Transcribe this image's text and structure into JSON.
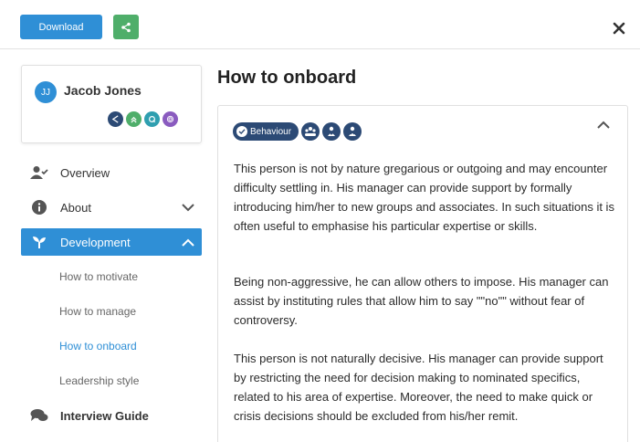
{
  "toolbar": {
    "download_label": "Download",
    "share_icon": "share-icon",
    "close_icon": "close-icon"
  },
  "profile": {
    "initials": "JJ",
    "name": "Jacob Jones",
    "trait_icons": [
      {
        "icon": "send-icon",
        "color": "#2c4a75"
      },
      {
        "icon": "chevrons-up-icon",
        "color": "#4fae6a"
      },
      {
        "icon": "q-icon",
        "color": "#2f9fb0"
      },
      {
        "icon": "rings-icon",
        "color": "#8a5bbf"
      }
    ]
  },
  "nav": {
    "overview": "Overview",
    "about": "About",
    "development": "Development",
    "sub_items": [
      "How to motivate",
      "How to manage",
      "How to onboard",
      "Leadership style"
    ],
    "interview_guide": "Interview Guide"
  },
  "main": {
    "title": "How to onboard",
    "badge": "Behaviour",
    "paragraphs": [
      "This person is not by nature gregarious or outgoing and may encounter difficulty settling in. His manager can provide  support by formally introducing him/her to new groups and associates. In such situations it is often useful to emphasise his particular expertise or skills.",
      "Being non-aggressive, he can allow others to impose. His manager can assist by instituting rules that allow him to say \"\"no\"\" without fear of controversy.",
      "This person is not naturally decisive. His manager can provide support by restricting the need for decision making to nominated specifics, related to his area of expertise. Moreover, the need to make quick or crisis decisions should be excluded from his/her remit."
    ]
  },
  "colors": {
    "accent": "#2f8fd6",
    "share": "#4fae6a",
    "badge": "#2c4a75"
  }
}
